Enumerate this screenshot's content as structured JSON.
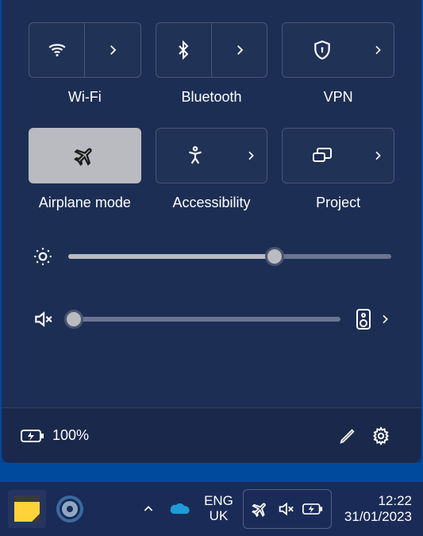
{
  "tiles": {
    "wifi": {
      "label": "Wi-Fi"
    },
    "bluetooth": {
      "label": "Bluetooth"
    },
    "vpn": {
      "label": "VPN"
    },
    "airplane": {
      "label": "Airplane mode",
      "active": true
    },
    "accessibility": {
      "label": "Accessibility"
    },
    "project": {
      "label": "Project"
    }
  },
  "sliders": {
    "brightness": {
      "value": 64
    },
    "volume": {
      "value": 2,
      "muted": true
    }
  },
  "footer": {
    "battery_text": "100%"
  },
  "taskbar": {
    "lang_line1": "ENG",
    "lang_line2": "UK",
    "time": "12:22",
    "date": "31/01/2023"
  }
}
